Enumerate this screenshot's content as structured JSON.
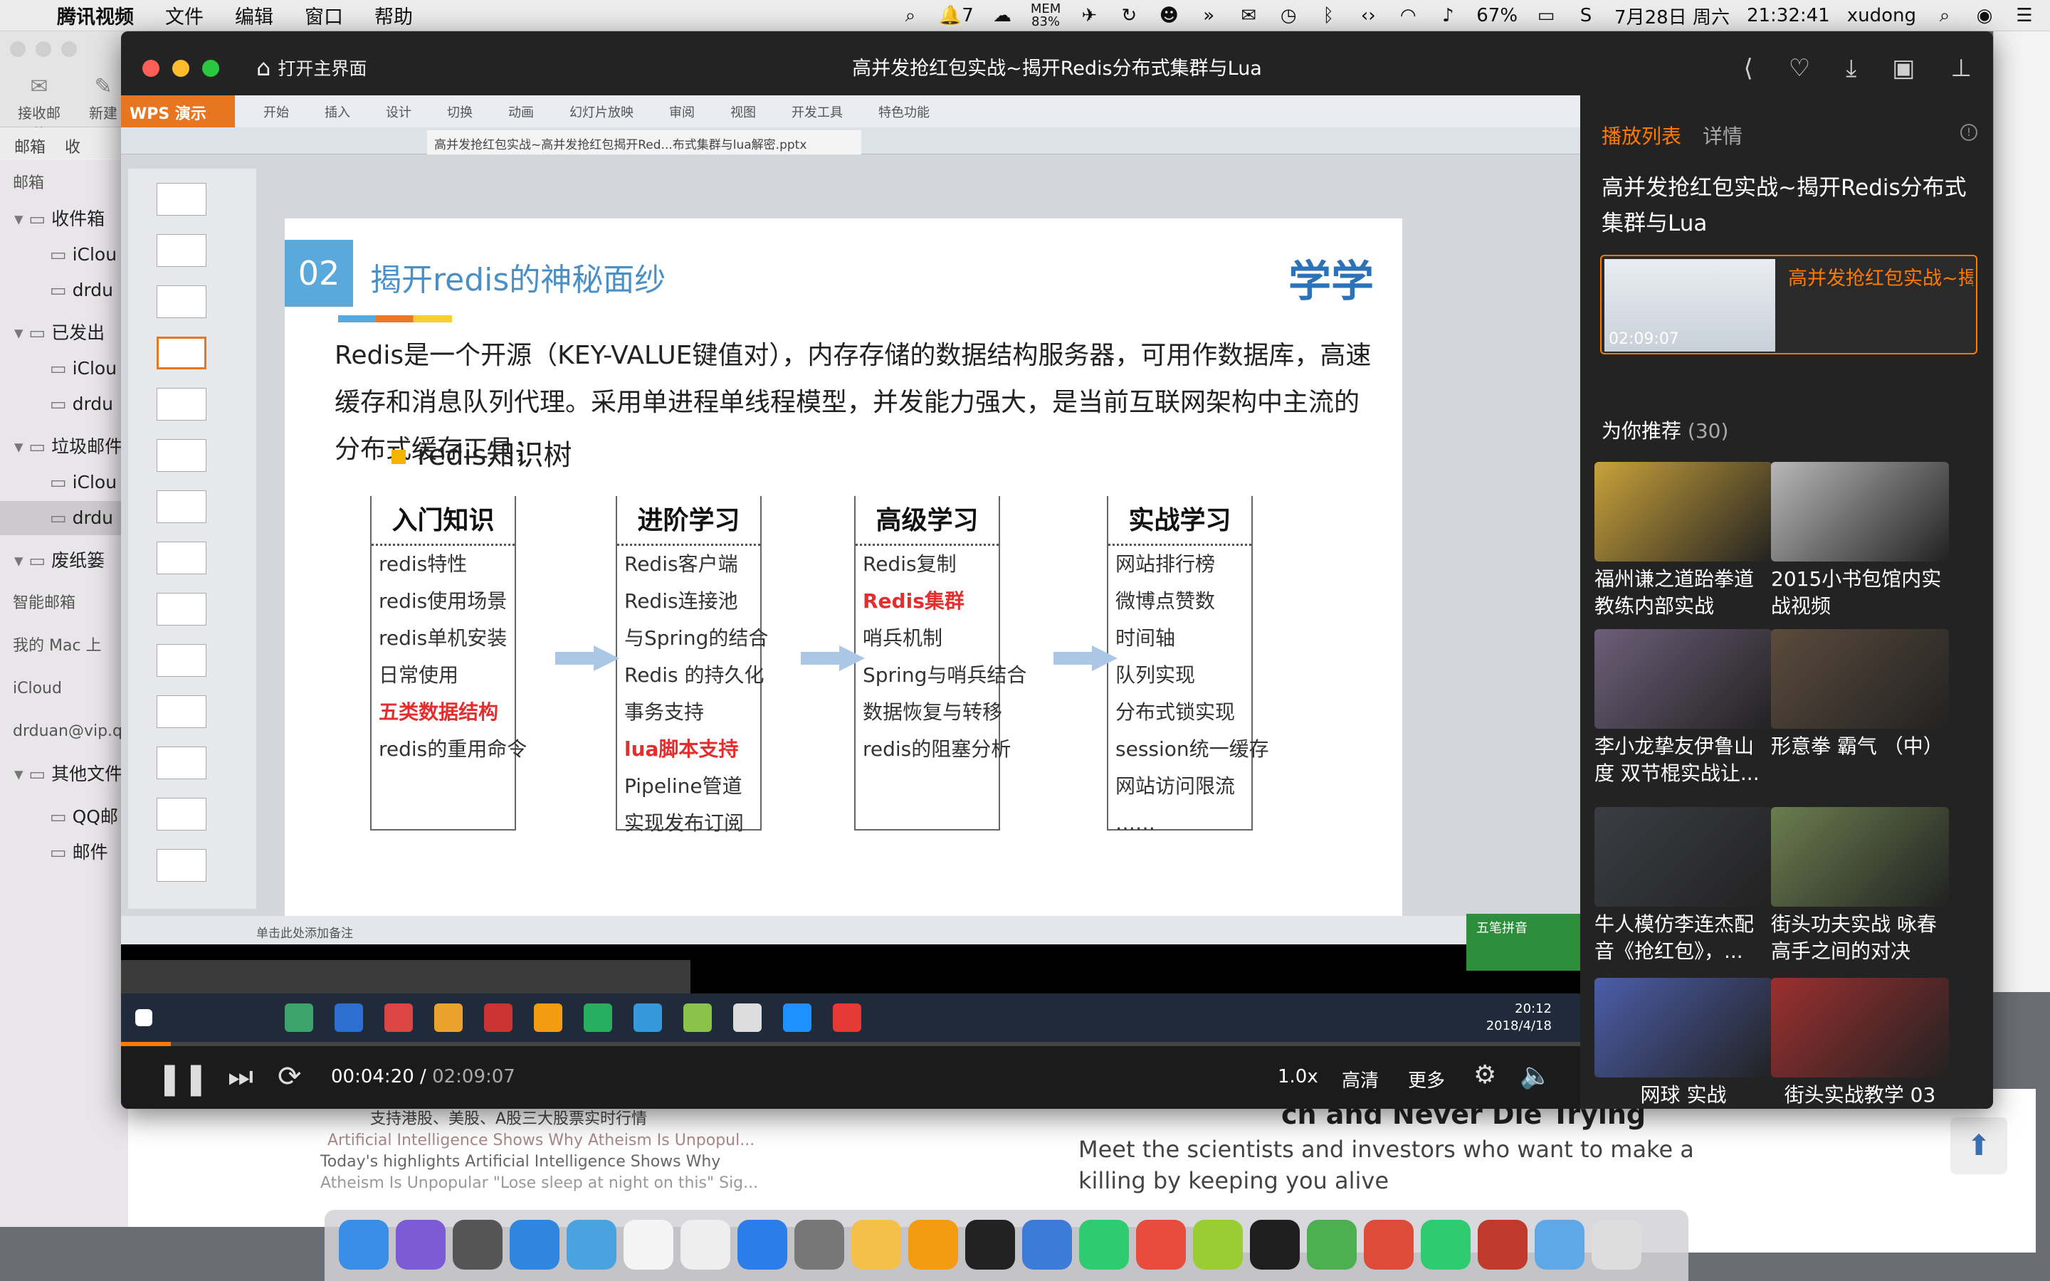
{
  "menubar": {
    "app_name": "腾讯视频",
    "menus": [
      "文件",
      "编辑",
      "窗口",
      "帮助"
    ],
    "status": {
      "notifications": "7",
      "mem_label": "MEM",
      "mem_value": "83%",
      "battery": "67%",
      "date": "7月28日 周六",
      "time": "21:32:41",
      "user": "xudong"
    }
  },
  "mail": {
    "toolbar": {
      "receive": "接收邮件",
      "compose": "新建"
    },
    "tabs": {
      "mailbox": "邮箱",
      "receive": "收"
    },
    "sidebar": [
      {
        "label": "邮箱",
        "kind": "head"
      },
      {
        "label": "收件箱",
        "kind": "folder"
      },
      {
        "label": "iClou",
        "kind": "sub"
      },
      {
        "label": "drdu",
        "kind": "sub"
      },
      {
        "label": "已发出",
        "kind": "folder"
      },
      {
        "label": "iClou",
        "kind": "sub"
      },
      {
        "label": "drdu",
        "kind": "sub"
      },
      {
        "label": "垃圾邮件",
        "kind": "folder"
      },
      {
        "label": "iClou",
        "kind": "sub"
      },
      {
        "label": "drdu",
        "kind": "sub"
      },
      {
        "label": "废纸篓",
        "kind": "folder"
      },
      {
        "label": "智能邮箱",
        "kind": "head"
      },
      {
        "label": "我的 Mac 上",
        "kind": "head"
      },
      {
        "label": "iCloud",
        "kind": "head"
      },
      {
        "label": "drduan@vip.qq",
        "kind": "head"
      },
      {
        "label": "其他文件",
        "kind": "folder"
      },
      {
        "label": "QQ邮",
        "kind": "sub"
      },
      {
        "label": "邮件",
        "kind": "sub"
      }
    ],
    "content": {
      "line1": "支持港股、美股、A股三大股票实时行情",
      "line2": "Artificial Intelligence Shows Why Atheism Is Unpopul...",
      "line3": "Today's highlights Artificial Intelligence Shows Why",
      "line4": "Atheism Is Unpopular \"Lose sleep at night on this\" Sig..."
    }
  },
  "browser": {
    "headline": "ch and Never Die Trying",
    "sub1": "Meet the scientists and investors who want to make a",
    "sub2": "killing by keeping you alive"
  },
  "player": {
    "home_label": "打开主界面",
    "title": "高并发抢红包实战~揭开Redis分布式集群与Lua",
    "controls": {
      "current_time": "00:04:20",
      "total_time": "02:09:07",
      "speed": "1.0x",
      "quality": "高清",
      "more": "更多"
    },
    "progress_fraction": 0.034
  },
  "video_frame": {
    "wps_logo": "WPS 演示",
    "wps_menus": [
      "开始",
      "插入",
      "设计",
      "切换",
      "动画",
      "幻灯片放映",
      "审阅",
      "视图",
      "开发工具",
      "特色功能"
    ],
    "tab_title": "高并发抢红包实战~高并发抢红包揭开Red...布式集群与lua解密.pptx",
    "slide": {
      "number": "02",
      "title": "揭开redis的神秘面纱",
      "logo": "学学",
      "paragraph": "Redis是一个开源（KEY-VALUE键值对），内存存储的数据结构服务器，可用作数据库，高速缓存和消息队列代理。采用单进程单线程模型，并发能力强大，是当前互联网架构中主流的分布式缓存工具；",
      "subtitle": "redis知识树",
      "boxes": [
        {
          "title": "入门知识",
          "items": [
            "redis特性",
            "redis使用场景",
            "redis单机安装",
            "日常使用",
            "五类数据结构",
            "redis的重用命令"
          ],
          "highlight": [
            4
          ]
        },
        {
          "title": "进阶学习",
          "items": [
            "Redis客户端",
            "Redis连接池",
            "与Spring的结合",
            "Redis 的持久化",
            "事务支持",
            "lua脚本支持",
            "Pipeline管道",
            "实现发布订阅"
          ],
          "highlight": [
            5
          ]
        },
        {
          "title": "高级学习",
          "items": [
            "Redis复制",
            "Redis集群",
            "哨兵机制",
            "Spring与哨兵结合",
            "数据恢复与转移",
            "redis的阻塞分析"
          ],
          "highlight": [
            1
          ]
        },
        {
          "title": "实战学习",
          "items": [
            "网站排行榜",
            "微博点赞数",
            "时间轴",
            "队列实现",
            "分布式锁实现",
            "session统一缓存",
            "网站访问限流",
            "……"
          ],
          "highlight": []
        }
      ]
    },
    "status_note": "单击此处添加备注",
    "taskbar_clock": {
      "time": "20:12",
      "date": "2018/4/18"
    },
    "green_panel": "五笔拼音"
  },
  "sidebar": {
    "tab_playlist": "播放列表",
    "tab_detail": "详情",
    "title": "高并发抢红包实战~揭开Redis分布式集群与Lua",
    "current": {
      "duration": "02:09:07",
      "title": "高并发抢红包实战~揭开Redis分布式..."
    },
    "recommend_label": "为你推荐",
    "recommend_count": "(30)",
    "recommendations": [
      {
        "title": "福州谦之道跆拳道教练内部实战"
      },
      {
        "title": "2015小书包馆内实战视频"
      },
      {
        "title": "李小龙挚友伊鲁山度 双节棍实战让..."
      },
      {
        "title": "形意拳 霸气 （中）"
      },
      {
        "title": "牛人模仿李连杰配音《抢红包》，..."
      },
      {
        "title": "街头功夫实战 咏春高手之间的对决"
      },
      {
        "title": "网球 实战"
      },
      {
        "title": "街头实战教学 03"
      }
    ]
  },
  "colors": {
    "accent": "#ff7a00",
    "player_bg": "#1b1b1b"
  }
}
